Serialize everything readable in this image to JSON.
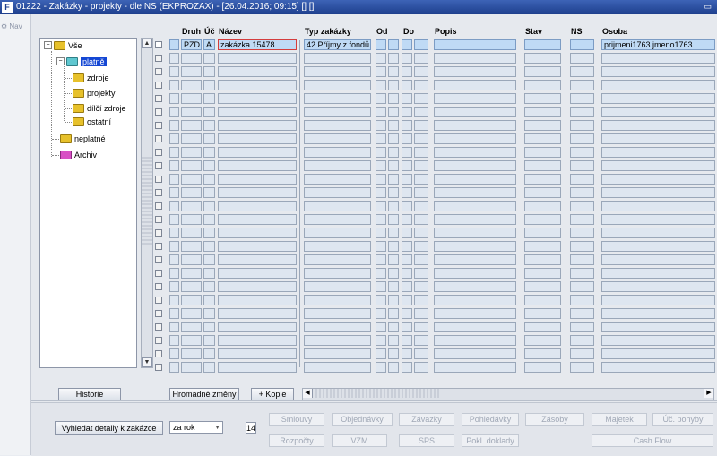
{
  "window": {
    "title": "01222 - Zakázky - projekty - dle NS (EKPROZAX) - [26.04.2016; 09:15] [] []"
  },
  "nav": {
    "label": "Nav"
  },
  "tree": {
    "root": "Vše",
    "platne": "platně",
    "children_platne": [
      "zdroje",
      "projekty",
      "dílčí zdroje",
      "ostatní"
    ],
    "neplatne": "neplatné",
    "archiv": "Archiv"
  },
  "grid": {
    "headers": {
      "druh": "Druh",
      "uc": "Úč",
      "nazev": "Název",
      "typ": "Typ zakázky",
      "od": "Od",
      "do": "Do",
      "popis": "Popis",
      "stav": "Stav",
      "ns": "NS",
      "osoba": "Osoba"
    },
    "first_row": {
      "druh": "PZD",
      "uc": "A",
      "nazev": "zakázka 15478",
      "typ": "42 Příjmy z fondů",
      "od": "",
      "do": "",
      "popis": "",
      "stav": "",
      "ns": "",
      "osoba": "prijmeni1763 jmeno1763"
    },
    "empty_rows": 24
  },
  "buttons": {
    "historie": "Historie",
    "hromadne": "Hromadné změny",
    "kopie": "+ Kopie",
    "vyhledat": "Vyhledat detaily k zakázce",
    "combo": "za rok",
    "year": "14",
    "row1": [
      "Smlouvy",
      "Objednávky",
      "Závazky",
      "Pohledávky",
      "Zásoby",
      "Majetek",
      "Úč. pohyby"
    ],
    "row2": [
      "Rozpočty",
      "VZM",
      "SPS",
      "Pokl. doklady",
      "Cash Flow"
    ]
  }
}
